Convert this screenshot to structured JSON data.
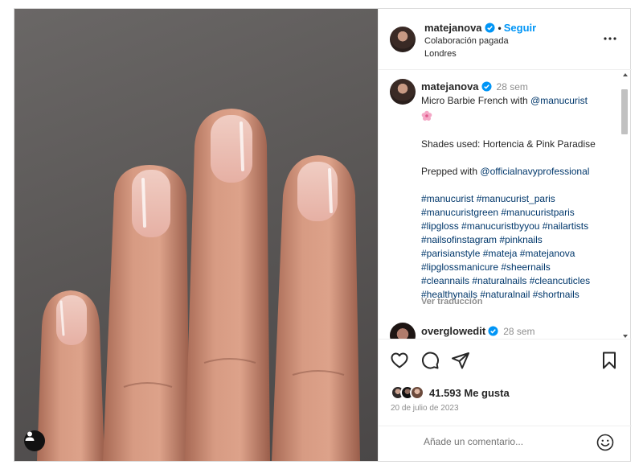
{
  "post": {
    "username": "matejanova",
    "follow_label": "Seguir",
    "subtitle1": "Colaboración pagada",
    "subtitle2": "Londres"
  },
  "caption": {
    "username": "matejanova",
    "time": "28 sem",
    "line1_text": "Micro Barbie French with ",
    "line1_mention": "@manucurist",
    "shades": "Shades used: Hortencia & Pink Paradise",
    "prepped_text": "Prepped with ",
    "prepped_mention": "@officialnavyprofessional",
    "hashtags": [
      "#manucurist #manucurist_paris",
      "#manucuristgreen #manucuristparis",
      "#lipgloss #manucuristbyyou #nailartists",
      "#nailsofinstagram #pinknails",
      "#parisianstyle #mateja #matejanova",
      "#lipglossmanicure #sheernails",
      "#cleannails #naturalnails #cleancuticles",
      "#healthynails #naturalnail #shortnails"
    ],
    "translate": "Ver traducción"
  },
  "comment2": {
    "username": "overglowedit",
    "time": "28 sem"
  },
  "icons": [
    "heart-icon",
    "comment-icon",
    "share-icon",
    "bookmark-icon",
    "more-options-icon",
    "emoji-icon",
    "user-tag-icon",
    "verified-icon"
  ],
  "stats": {
    "likes": "41.593 Me gusta",
    "date": "20 de julio de 2023"
  },
  "comment_box": {
    "placeholder": "Añade un comentario..."
  },
  "colors": {
    "accent": "#0095f6",
    "link": "#00376b",
    "muted": "#8e8e8e"
  }
}
